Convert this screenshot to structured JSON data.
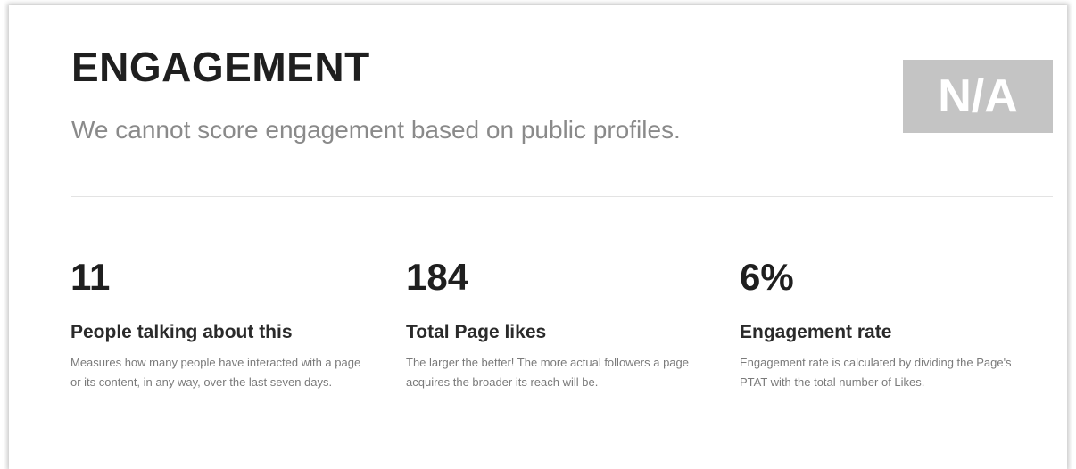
{
  "engagement": {
    "title": "ENGAGEMENT",
    "subtitle": "We cannot score engagement based on public profiles.",
    "score": "N/A"
  },
  "metrics": [
    {
      "value": "11",
      "label": "People talking about this",
      "description": "Measures how many people have interacted with a page or its content, in any way, over the last seven days."
    },
    {
      "value": "184",
      "label": "Total Page likes",
      "description": "The larger the better! The more actual followers a page acquires the broader its reach will be."
    },
    {
      "value": "6%",
      "label": "Engagement rate",
      "description": "Engagement rate is calculated by dividing the Page's PTAT with the total number of Likes."
    }
  ],
  "colors": {
    "score_badge_bg": "#c4c4c4",
    "title_text": "#1f1f1f",
    "subtitle_text": "#8a8a8a"
  }
}
